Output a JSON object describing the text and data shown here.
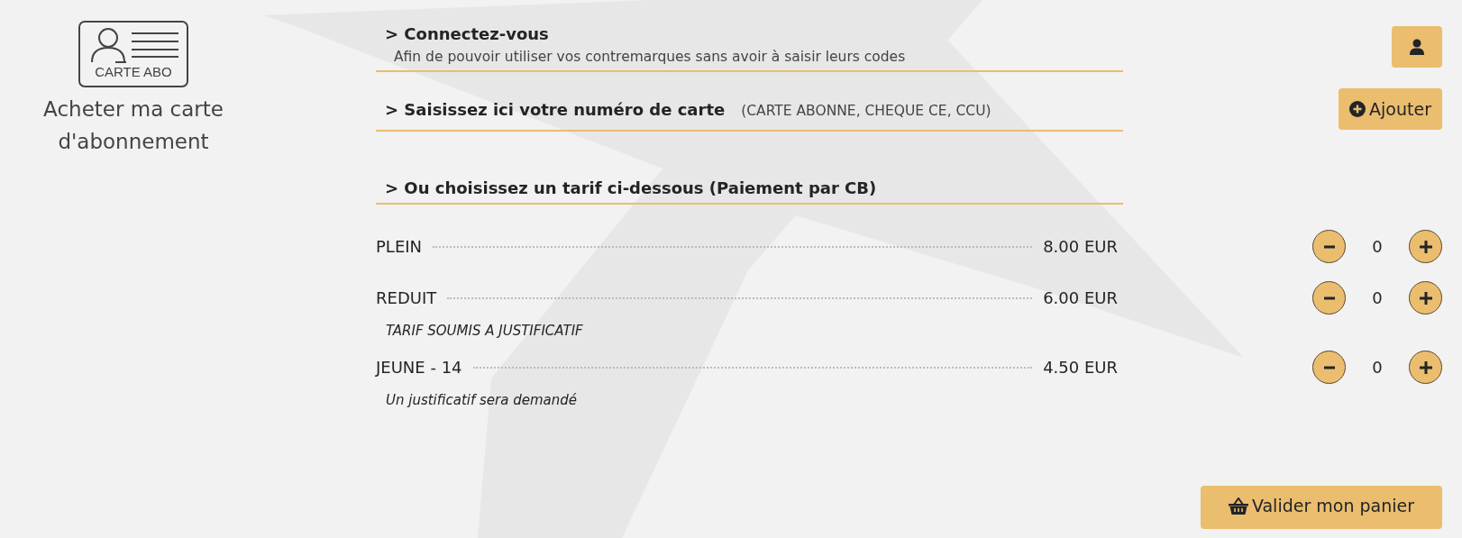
{
  "sidebar": {
    "card_label": "CARTE ABO",
    "title": "Acheter ma carte d'abonnement"
  },
  "login": {
    "heading": "> Connectez-vous",
    "description": "Afin de pouvoir utiliser vos contremarques sans avoir à saisir leurs codes"
  },
  "card_number": {
    "heading": "> Saisissez ici votre numéro de carte",
    "hint": "(CARTE ABONNE, CHEQUE CE, CCU)",
    "button": "Ajouter"
  },
  "tariffs": {
    "heading": "> Ou choisissez un tarif ci-dessous (Paiement par CB)",
    "items": [
      {
        "name": "PLEIN",
        "price": "8.00 EUR",
        "quantity": "0"
      },
      {
        "name": "REDUIT",
        "price": "6.00 EUR",
        "note": "TARIF SOUMIS A JUSTIFICATIF",
        "quantity": "0"
      },
      {
        "name": "JEUNE - 14",
        "price": "4.50 EUR",
        "note": "Un justificatif sera demandé",
        "quantity": "0"
      }
    ]
  },
  "checkout_button": "Valider mon panier"
}
